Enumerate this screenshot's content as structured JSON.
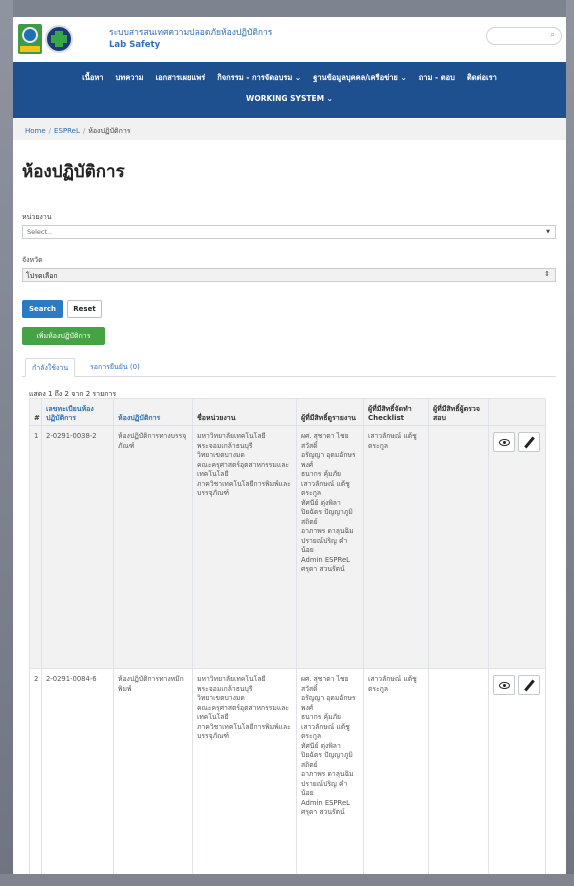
{
  "header": {
    "title_th": "ระบบสารสนเทศความปลอดภัยห้องปฏิบัติการ",
    "title_en": "Lab Safety",
    "search_placeholder": ""
  },
  "nav": {
    "items": [
      "เนื้อหา",
      "บทความ",
      "เอกสารเผยแพร่",
      "กิจกรรม - การจัดอบรม ⌄",
      "ฐานข้อมูลบุคคล/เครือข่าย ⌄",
      "ถาม - ตอบ",
      "ติดต่อเรา"
    ],
    "working_system": "WORKING SYSTEM ⌄"
  },
  "breadcrumb": {
    "home": "Home",
    "esprel": "ESPReL",
    "current": "ห้องปฏิบัติการ"
  },
  "page_title": "ห้องปฏิบัติการ",
  "filters": {
    "unit_label": "หน่วยงาน",
    "unit_placeholder": "Select..",
    "province_label": "จังหวัด",
    "province_value": "โปรดเลือก",
    "search_button": "Search",
    "reset_button": "Reset",
    "add_button": "เพิ่มห้องปฏิบัติการ"
  },
  "tabs": {
    "active": "กำลังใช้งาน",
    "pending": "รอการยืนยัน (0)"
  },
  "count_info": "แสดง 1 ถึง 2 จาก 2 รายการ",
  "table": {
    "headers": [
      "#",
      "เลขทะเบียนห้องปฏิบัติการ",
      "ห้องปฏิบัติการ",
      "ชื่อหน่วยงาน",
      "ผู้ที่มีสิทธิ์ดูรายงาน",
      "ผู้ที่มีสิทธิ์จัดทำ Checklist",
      "ผู้ที่มีสิทธิ์ผู้ตรวจสอบ",
      ""
    ],
    "rows": [
      {
        "num": "1",
        "reg": "2-0291-0038-2",
        "lab": "ห้องปฏิบัติการทางบรรจุภัณฑ์",
        "unit": "มหาวิทยาลัยเทคโนโลยีพระจอมเกล้าธนบุรี\nวิทยาเขตบางมด\nคณะครุศาสตร์อุตสาหกรรมและเทคโนโลยี\nภาควิชาเทคโนโลยีการพิมพ์และบรรจุภัณฑ์",
        "viewers": "ผศ. สุชาดา ไชยสวัสดิ์\nอรัญญา อุดมอักษรพงศ์\nธนากร คุ้มภัย\nเสาวลักษณ์ แต้ชูตระกูล\nทัศนีย์ ตุ่งพิลา\nปิยฉัตร ปัญญาภูมิสถิตย์\nอาภาพร ดาลุนฉิม\nปรายณ์ปริญ คำน้อย\nAdmin ESPReL\nศรุดา สวนรัตน์",
        "checklist": "เสาวลักษณ์ แต้ชูตระกูล",
        "auditor": ""
      },
      {
        "num": "2",
        "reg": "2-0291-0084-6",
        "lab": "ห้องปฏิบัติการทางหมึกพิมพ์",
        "unit": "มหาวิทยาลัยเทคโนโลยีพระจอมเกล้าธนบุรี\nวิทยาเขตบางมด\nคณะครุศาสตร์อุตสาหกรรมและเทคโนโลยี\nภาควิชาเทคโนโลยีการพิมพ์และบรรจุภัณฑ์",
        "viewers": "ผศ. สุชาดา ไชยสวัสดิ์\nอรัญญา อุดมอักษรพงศ์\nธนากร คุ้มภัย\nเสาวลักษณ์ แต้ชูตระกูล\nทัศนีย์ ตุ่งพิลา\nปิยฉัตร ปัญญาภูมิสถิตย์\nอาภาพร ดาลุนฉิม\nปรายณ์ปริญ คำน้อย\nAdmin ESPReL\nศรุดา สวนรัตน์",
        "checklist": "เสาวลักษณ์ แต้ชูตระกูล",
        "auditor": ""
      }
    ]
  },
  "colors": {
    "nav_bg": "#1e4f8f",
    "link": "#2f6fb6",
    "search_btn": "#2a7ac4",
    "add_btn": "#46a343"
  },
  "icons": {
    "view": "eye-icon",
    "edit": "pencil-icon",
    "search": "search-icon"
  }
}
